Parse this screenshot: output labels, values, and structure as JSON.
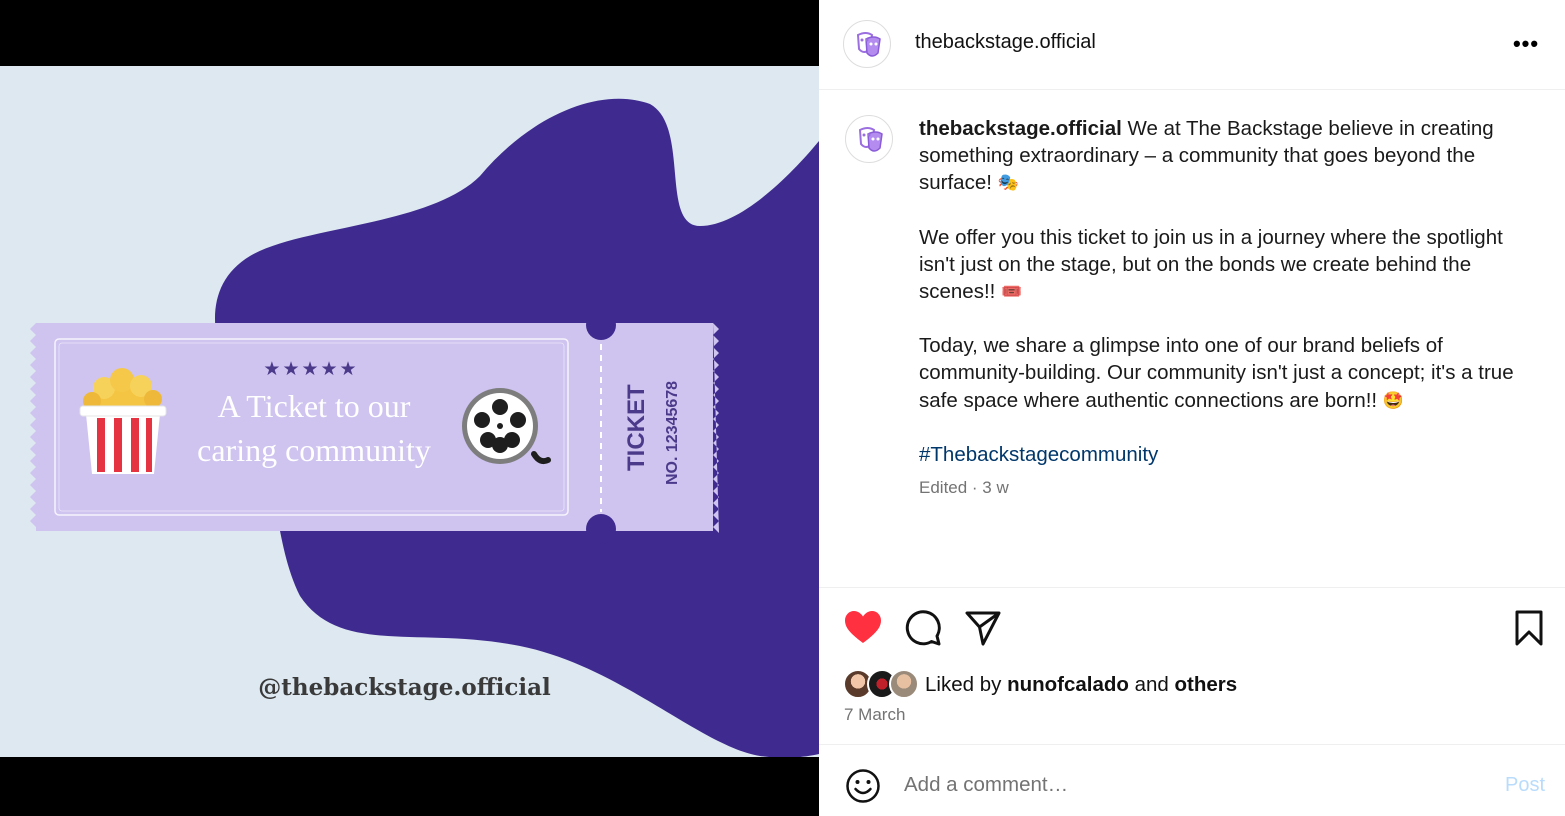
{
  "post": {
    "username": "thebackstage.official",
    "more_icon_label": "•••",
    "image": {
      "ticket_title_line1": "A Ticket to our",
      "ticket_title_line2": "caring community",
      "ticket_stars": "★★★★★",
      "ticket_word": "TICKET",
      "ticket_number": "NO. 12345678",
      "handle": "@thebackstage.official"
    },
    "caption": {
      "username": "thebackstage.official",
      "para1": " We at The Backstage believe in creating something extraordinary – a community that goes beyond the surface! ",
      "para1_emoji": "🎭",
      "para2": "We offer you this ticket to join us in a journey where the spotlight isn't just on the stage, but on the bonds we create behind the scenes!! ",
      "para2_emoji": "🎟️",
      "para3": "Today, we share a glimpse into one of our brand beliefs of community-building. Our community isn't just a concept; it's a true safe space where authentic connections are born!! ",
      "para3_emoji": "🤩",
      "hashtag": "#Thebackstagecommunity"
    },
    "edited_label": "Edited · 3 w",
    "liked_by_prefix": "Liked by ",
    "liked_by_user": "nunofcalado",
    "liked_by_and": " and ",
    "liked_by_others": "others",
    "date": "7 March",
    "comment_placeholder": "Add a comment…",
    "post_button": "Post"
  },
  "colors": {
    "blob": "#3f2b8f",
    "ticket": "#cfc3f0",
    "ticket_text": "#ffffff",
    "ticket_dark": "#4b3a8a",
    "background": "#dde8f1",
    "like": "#ff3040",
    "link": "#00376b",
    "post_button": "#b9dcfc"
  },
  "icons": [
    "theatre-masks-icon",
    "heart-icon",
    "comment-icon",
    "share-icon",
    "bookmark-icon",
    "smiley-icon",
    "popcorn-icon",
    "film-reel-icon"
  ]
}
